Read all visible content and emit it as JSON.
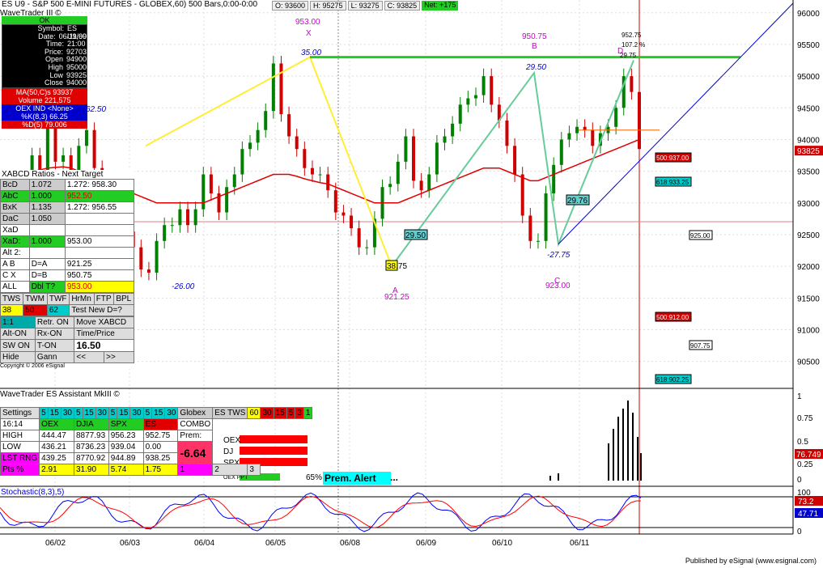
{
  "header": {
    "title": "ES U9 - S&P 500 E-MINI FUTURES - GLOBEX,60) 500 Bars,0:00-0:00",
    "ohlc": [
      {
        "k": "O",
        "v": "93600"
      },
      {
        "k": "H",
        "v": "95275"
      },
      {
        "k": "L",
        "v": "93275"
      },
      {
        "k": "C",
        "v": "93825"
      }
    ],
    "net": "Net: +175",
    "study_title": "WaveTrader III ©"
  },
  "info_box": {
    "ok": "OK",
    "rows": [
      {
        "k": "Symbol:",
        "v": "ES U9,60"
      },
      {
        "k": "Date:",
        "v": "06/11/09"
      },
      {
        "k": "Time:",
        "v": "21:00"
      },
      {
        "k": "Price:",
        "v": "92703"
      },
      {
        "k": "Open",
        "v": "94900"
      },
      {
        "k": "High",
        "v": "95000"
      },
      {
        "k": "Low",
        "v": "93925"
      },
      {
        "k": "Close",
        "v": "94000"
      }
    ],
    "ma": "MA(50,C)s 93937",
    "volume": "Volume 221,575",
    "oex": "OEX IND <None>",
    "k": "%K(8,3) 66.25",
    "d": "%D(5) 79.006"
  },
  "xabcd": {
    "title": "XABCD Ratios - Next Target",
    "rows": [
      [
        "BcD",
        "1.072",
        "1.272: 958.30"
      ],
      [
        "AbC",
        "1.000",
        "952.50"
      ],
      [
        "BxK",
        "1.135",
        "1.272: 956.55"
      ],
      [
        "DaC",
        "1.050",
        ""
      ],
      [
        "XaD",
        "",
        ""
      ],
      [
        "XaD:",
        "1.000",
        "953.00"
      ],
      [
        "Alt 2:",
        "",
        ""
      ],
      [
        "A B",
        "D=A",
        "921.25"
      ],
      [
        "C X",
        "D=B",
        "950.75"
      ],
      [
        "ALL",
        "Dbl T?",
        "953.00"
      ]
    ],
    "tabs": [
      "TWS",
      "TWM",
      "TWF",
      "HrMn",
      "FTP",
      "BPL"
    ],
    "tab_vals": [
      "38",
      "50",
      "62",
      "Test New D=?"
    ],
    "ctrl": [
      [
        "1:1",
        "Retr. ON",
        "Move XABCD"
      ],
      [
        "Alt-ON",
        "Rx-ON",
        "Time/Price"
      ],
      [
        "SW ON",
        "T-ON",
        "16.50"
      ],
      [
        "Hide",
        "Gann",
        "<<",
        ">>"
      ]
    ],
    "copyright": "Copyright © 2006 eSignal"
  },
  "assistant": {
    "title": "WaveTrader ES Assistant MkIII ©",
    "settings": "Settings",
    "intervals": [
      "5",
      "15",
      "30"
    ],
    "globex": "Globex",
    "es_tws": "ES TWS",
    "vals": [
      "60",
      "30",
      "15",
      "5",
      "3",
      "1"
    ],
    "time": "16:14",
    "cols": [
      "OEX",
      "DJIA",
      "SPX",
      "ES"
    ],
    "combo": "COMBO",
    "prem": "Prem:",
    "rows": [
      {
        "k": "HIGH",
        "v": [
          "444.47",
          "8877.93",
          "956.23",
          "952.75"
        ]
      },
      {
        "k": "LOW",
        "v": [
          "436.21",
          "8736.23",
          "939.04",
          "0.00"
        ]
      },
      {
        "k": "LST RNG",
        "v": [
          "439.25",
          "8770.92",
          "944.89",
          "938.25"
        ]
      },
      {
        "k": "Pts %",
        "v": [
          "2.91",
          "31.90",
          "5.74",
          "1.75"
        ]
      }
    ],
    "combo_val": "-6.64",
    "idx": [
      "OEX",
      "DJ",
      "SPX"
    ],
    "page": [
      "1",
      "2",
      "3"
    ],
    "oex_ppt": "OEX PPT",
    "pct": "65%",
    "alert": "Prem. Alert",
    "dots": "..."
  },
  "stoch": {
    "title": "Stochastic(8,3),5)"
  },
  "footer": "Published by eSignal (www.esignal.com)",
  "colors": {
    "up": "#008000",
    "down": "#d00000",
    "ma": "#e00000",
    "pattern": "#66cc99",
    "xa": "#ffee33",
    "target": "#22cc22",
    "trend": "#0000cc"
  },
  "chart_data": {
    "type": "line",
    "title": "ES U9 - S&P 500 E-MINI FUTURES - GLOBEX,60) 500 Bars,0:00-0:00",
    "x_ticks": [
      "06/02",
      "06/03",
      "06/04",
      "06/05",
      "06/08",
      "06/09",
      "06/10",
      "06/11"
    ],
    "y_ticks": [
      "96000",
      "95500",
      "95000",
      "94500",
      "94000",
      "93500",
      "93000",
      "92500",
      "92000",
      "91500",
      "91000",
      "90500"
    ],
    "ylim": [
      90100,
      96150
    ],
    "series": [
      {
        "name": "Price",
        "values": [
          93450,
          93750,
          93350,
          94350,
          93650,
          93750,
          93450,
          93900,
          94150,
          93550,
          93250,
          93050,
          92600,
          92550,
          92300,
          91950,
          91900,
          92400,
          92650,
          92650,
          92900,
          92650,
          92900,
          93450,
          93150,
          92850,
          93250,
          93450,
          93850,
          93950,
          94150,
          94450,
          95200,
          94400,
          94050,
          93850,
          93550,
          93450,
          93450,
          93200,
          92850,
          92800,
          92600,
          92300,
          92300,
          92750,
          93250,
          93300,
          93650,
          94050,
          93350,
          93200,
          93450,
          93950,
          94050,
          94250,
          94550,
          94650,
          94700,
          95000,
          94550,
          94300,
          93900,
          93450,
          92800,
          92400,
          92400,
          93150,
          93600,
          94000,
          94100,
          94200,
          94150,
          93900,
          94100,
          94200,
          94500,
          95000,
          94750,
          93850
        ]
      },
      {
        "name": "MA(50,C)",
        "values": [
          93450,
          93500,
          93520,
          93550,
          93560,
          93570,
          93550,
          93500,
          93450,
          93400,
          93350,
          93300,
          93250,
          93200,
          93150,
          93100,
          93050,
          93000,
          93000,
          93000,
          93000,
          93000,
          93000,
          93000,
          93050,
          93100,
          93150,
          93200,
          93250,
          93300,
          93350,
          93400,
          93450,
          93450,
          93450,
          93420,
          93380,
          93350,
          93320,
          93300,
          93250,
          93200,
          93150,
          93100,
          93050,
          93000,
          93000,
          93000,
          93000,
          93050,
          93100,
          93150,
          93200,
          93250,
          93300,
          93350,
          93400,
          93450,
          93500,
          93550,
          93550,
          93550,
          93500,
          93450,
          93400,
          93350,
          93350,
          93400,
          93450,
          93500,
          93550,
          93600,
          93650,
          93700,
          93750,
          93800,
          93850,
          93900,
          93950,
          94000
        ]
      }
    ],
    "pattern_points": [
      {
        "label": "X",
        "value": 953.0,
        "sub": "35.00"
      },
      {
        "label": "A",
        "value": 921.25,
        "sub": "38.75"
      },
      {
        "label": "B",
        "value": 950.75,
        "sub": "29.50"
      },
      {
        "label": "C",
        "value": 923.0,
        "sub": "-27.75"
      },
      {
        "label": "D",
        "value": 952.75,
        "sub": "29.75"
      }
    ],
    "extra_labels": [
      "62.50",
      "-26.00",
      "29.50",
      "29.76",
      "107.2 %"
    ],
    "right_labels": [
      {
        "text": "500:937.00",
        "color": "red"
      },
      {
        "text": "618:933.25",
        "color": "cyan"
      },
      {
        "text": "925.00",
        "color": "white"
      },
      {
        "text": "500:912.00",
        "color": "red"
      },
      {
        "text": "907.75",
        "color": "white"
      },
      {
        "text": "618:902.25",
        "color": "cyan"
      }
    ],
    "last_price": "93825",
    "volume_axis": [
      "1",
      "0.75",
      "0.5",
      "0.25",
      "0"
    ],
    "volume_last": "76.749",
    "stoch_axis": [
      "100",
      "0"
    ],
    "stoch_vals": [
      "73.2",
      "47.71"
    ],
    "grid": true
  }
}
